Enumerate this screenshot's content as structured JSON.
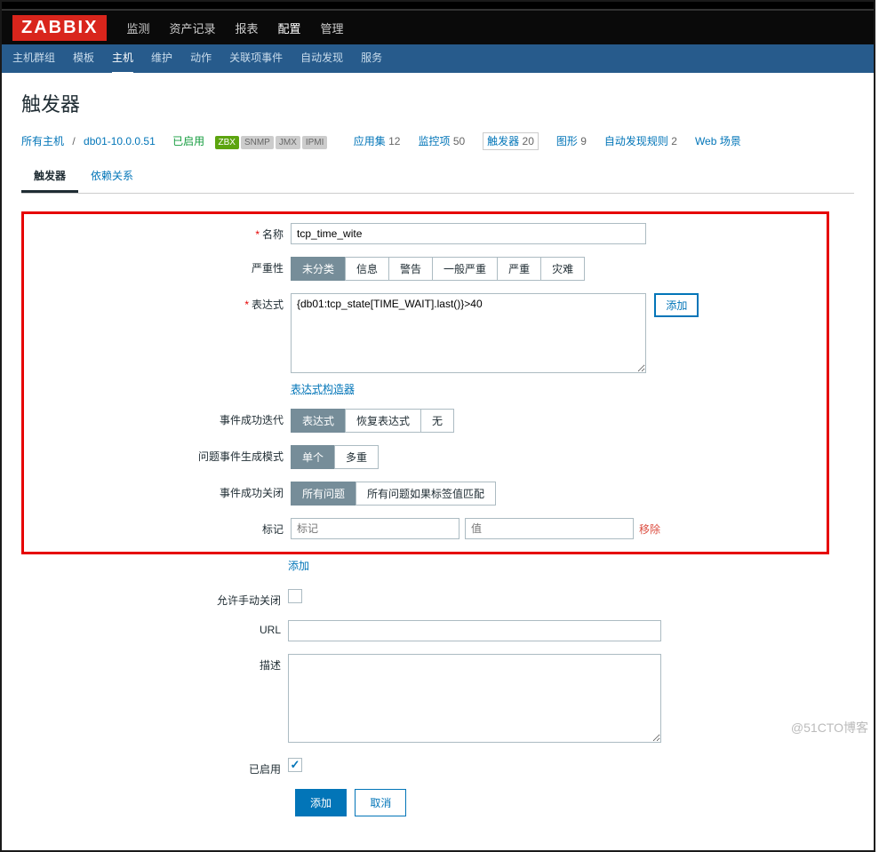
{
  "logo": "ZABBIX",
  "mainNav": {
    "items": [
      "监测",
      "资产记录",
      "报表",
      "配置",
      "管理"
    ],
    "active": "配置"
  },
  "subNav": {
    "items": [
      "主机群组",
      "模板",
      "主机",
      "维护",
      "动作",
      "关联项事件",
      "自动发现",
      "服务"
    ],
    "active": "主机"
  },
  "page": {
    "title": "触发器"
  },
  "breadcrumb": {
    "allHosts": "所有主机",
    "host": "db01-10.0.0.51",
    "enabled": "已启用",
    "badges": [
      "ZBX",
      "SNMP",
      "JMX",
      "IPMI"
    ],
    "stats": [
      {
        "label": "应用集",
        "count": "12"
      },
      {
        "label": "监控项",
        "count": "50"
      },
      {
        "label": "触发器",
        "count": "20",
        "current": true
      },
      {
        "label": "图形",
        "count": "9"
      },
      {
        "label": "自动发现规则",
        "count": "2"
      },
      {
        "label": "Web 场景",
        "count": ""
      }
    ]
  },
  "tabs": {
    "items": [
      "触发器",
      "依赖关系"
    ],
    "active": "触发器"
  },
  "form": {
    "labels": {
      "name": "名称",
      "severity": "严重性",
      "expression": "表达式",
      "exprBuilder": "表达式构造器",
      "eventGen": "事件成功迭代",
      "problemMode": "问题事件生成模式",
      "okClose": "事件成功关闭",
      "tags": "标记",
      "tagAdd": "添加",
      "tagRemove": "移除",
      "tagNamePh": "标记",
      "tagValuePh": "值",
      "allowManual": "允许手动关闭",
      "url": "URL",
      "description": "描述",
      "enabled": "已启用",
      "add": "添加",
      "cancel": "取消",
      "exprAdd": "添加"
    },
    "values": {
      "name": "tcp_time_wite",
      "expression": "{db01:tcp_state[TIME_WAIT].last()}>40",
      "url": "",
      "description": "",
      "enabled": true,
      "allowManual": false
    },
    "severityOptions": [
      "未分类",
      "信息",
      "警告",
      "一般严重",
      "严重",
      "灾难"
    ],
    "severitySelected": "未分类",
    "eventGenOptions": [
      "表达式",
      "恢复表达式",
      "无"
    ],
    "eventGenSelected": "表达式",
    "problemModeOptions": [
      "单个",
      "多重"
    ],
    "problemModeSelected": "单个",
    "okCloseOptions": [
      "所有问题",
      "所有问题如果标签值匹配"
    ],
    "okCloseSelected": "所有问题"
  },
  "watermark": "@51CTO博客"
}
